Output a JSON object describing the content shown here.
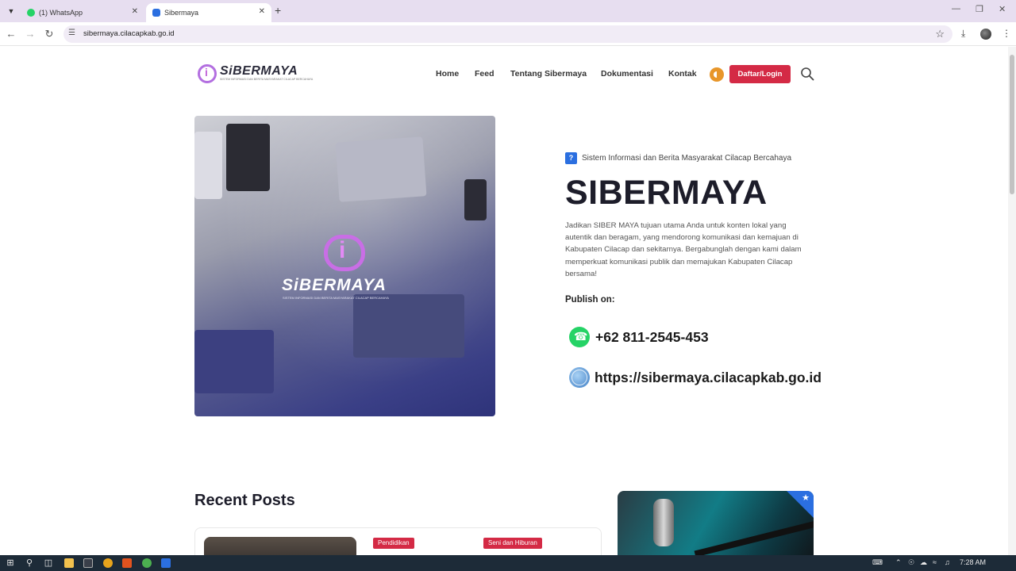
{
  "browser": {
    "tabs": [
      {
        "title": "(1) WhatsApp",
        "active": false,
        "favicon_color": "#25d366"
      },
      {
        "title": "Sibermaya",
        "active": true,
        "favicon_color": "#2b6fe0"
      }
    ],
    "url": "sibermaya.cilacapkab.go.id"
  },
  "site": {
    "logo_text": "SiBERMAYA",
    "logo_tagline": "SISTEM INFORMASI DAN BERITA MASYARAKAT CILACAP BERCAHAYA",
    "nav": [
      "Home",
      "Feed",
      "Tentang Sibermaya",
      "Dokumentasi",
      "Kontak"
    ],
    "login_label": "Daftar/Login",
    "accent_color": "#d42a45"
  },
  "hero": {
    "image_logo_text": "SiBERMAYA",
    "image_logo_tagline": "SISTEM INFORMASI DAN BERITA MASYARAKAT CILACAP BERCAHAYA",
    "tagline": "Sistem Informasi dan Berita Masyarakat Cilacap Bercahaya",
    "title": "SIBERMAYA",
    "description": "Jadikan SIBER MAYA tujuan utama Anda untuk konten lokal yang autentik dan beragam, yang mendorong komunikasi dan kemajuan di Kabupaten Cilacap dan sekitarnya. Bergabunglah dengan kami dalam memperkuat komunikasi publik dan memajukan Kabupaten Cilacap bersama!",
    "publish_label": "Publish on:",
    "phone": "+62 811-2545-453",
    "website": "https://sibermaya.cilacapkab.go.id"
  },
  "recent": {
    "title": "Recent Posts",
    "badges": [
      "Pendidikan",
      "Seni dan Hiburan"
    ]
  },
  "taskbar": {
    "time": "7:28 AM"
  }
}
